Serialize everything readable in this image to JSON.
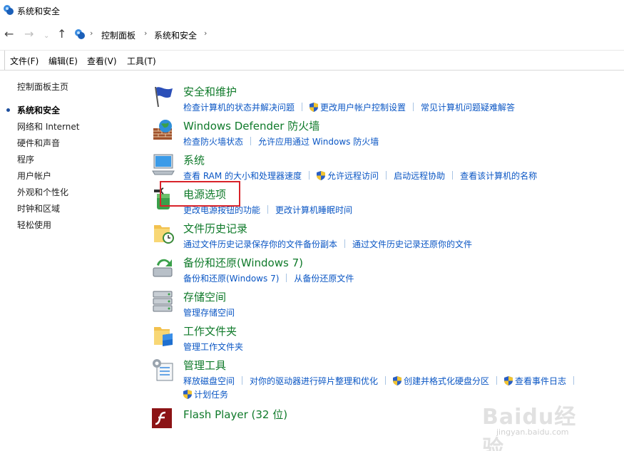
{
  "window": {
    "title": "系统和安全"
  },
  "address": {
    "crumbs": [
      "控制面板",
      "系统和安全"
    ]
  },
  "menu": [
    "文件(F)",
    "编辑(E)",
    "查看(V)",
    "工具(T)"
  ],
  "sidebar": {
    "home": "控制面板主页",
    "items": [
      "系统和安全",
      "网络和 Internet",
      "硬件和声音",
      "程序",
      "用户帐户",
      "外观和个性化",
      "时钟和区域",
      "轻松使用"
    ],
    "current": "系统和安全"
  },
  "categories": [
    {
      "icon": "flag-icon",
      "title": "安全和维护",
      "links": [
        {
          "text": "检查计算机的状态并解决问题"
        },
        {
          "text": "更改用户帐户控制设置",
          "shield": true
        },
        {
          "text": "常见计算机问题疑难解答"
        }
      ]
    },
    {
      "icon": "firewall-icon",
      "title": "Windows Defender 防火墙",
      "links": [
        {
          "text": "检查防火墙状态"
        },
        {
          "text": "允许应用通过 Windows 防火墙"
        }
      ]
    },
    {
      "icon": "computer-icon",
      "title": "系统",
      "links": [
        {
          "text": "查看 RAM 的大小和处理器速度"
        },
        {
          "text": "允许远程访问",
          "shield": true
        },
        {
          "text": "启动远程协助"
        },
        {
          "text": "查看该计算机的名称"
        }
      ]
    },
    {
      "icon": "power-icon",
      "title": "电源选项",
      "links": [
        {
          "text": "更改电源按钮的功能"
        },
        {
          "text": "更改计算机睡眠时间"
        }
      ]
    },
    {
      "icon": "file-history-icon",
      "title": "文件历史记录",
      "links": [
        {
          "text": "通过文件历史记录保存你的文件备份副本"
        },
        {
          "text": "通过文件历史记录还原你的文件"
        }
      ]
    },
    {
      "icon": "backup-icon",
      "title": "备份和还原(Windows 7)",
      "links": [
        {
          "text": "备份和还原(Windows 7)"
        },
        {
          "text": "从备份还原文件"
        }
      ]
    },
    {
      "icon": "storage-icon",
      "title": "存储空间",
      "links": [
        {
          "text": "管理存储空间"
        }
      ]
    },
    {
      "icon": "work-folder-icon",
      "title": "工作文件夹",
      "links": [
        {
          "text": "管理工作文件夹"
        }
      ]
    },
    {
      "icon": "admin-tools-icon",
      "title": "管理工具",
      "links": [
        {
          "text": "释放磁盘空间"
        },
        {
          "text": "对你的驱动器进行碎片整理和优化"
        },
        {
          "text": "创建并格式化硬盘分区",
          "shield": true
        },
        {
          "text": "查看事件日志",
          "shield": true
        }
      ],
      "links2": [
        {
          "text": "计划任务",
          "shield": true
        }
      ]
    },
    {
      "icon": "flash-icon",
      "title": "Flash Player (32 位)",
      "links": []
    }
  ],
  "watermark": {
    "brand": "Baidu经验",
    "url": "jingyan.baidu.com"
  },
  "colors": {
    "title_green": "#0f7a2a",
    "link_blue": "#0a56c4",
    "highlight_red": "#d8232a"
  }
}
